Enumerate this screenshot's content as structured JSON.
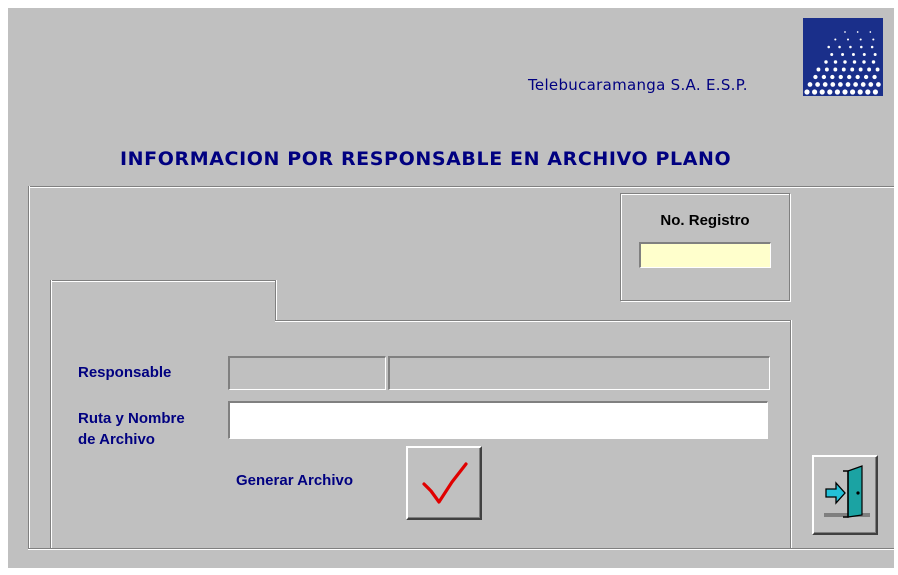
{
  "header": {
    "company": "Telebucaramanga S.A. E.S.P.",
    "title": "INFORMACION POR RESPONSABLE EN ARCHIVO PLANO",
    "logo_icon": "globe-dots-logo-icon"
  },
  "registro": {
    "label": "No. Registro",
    "value": ""
  },
  "form": {
    "responsable_label": "Responsable",
    "responsable_code": "",
    "responsable_name": "",
    "ruta_label_line1": "Ruta y Nombre",
    "ruta_label_line2": "de Archivo",
    "ruta_value": "",
    "generar_label": "Generar Archivo",
    "generar_icon": "checkmark-icon"
  },
  "actions": {
    "exit_icon": "exit-door-icon"
  },
  "colors": {
    "background": "#c0c0c0",
    "title_text": "#000080",
    "registro_input": "#ffffcc",
    "check": "#e00000"
  }
}
